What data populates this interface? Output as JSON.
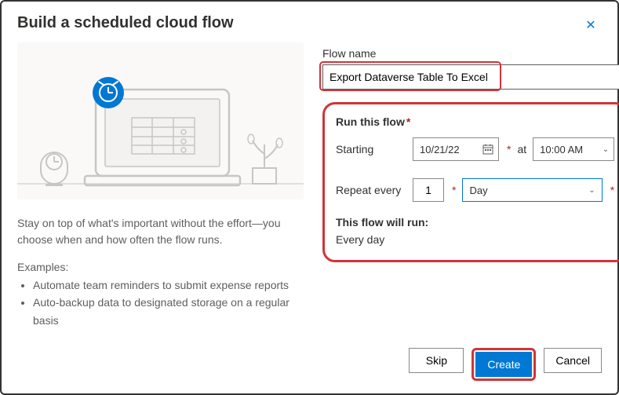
{
  "dialog": {
    "title": "Build a scheduled cloud flow"
  },
  "left": {
    "description": "Stay on top of what's important without the effort—you choose when and how often the flow runs.",
    "examples_label": "Examples:",
    "examples": [
      "Automate team reminders to submit expense reports",
      "Auto-backup data to designated storage on a regular basis"
    ]
  },
  "form": {
    "flow_name_label": "Flow name",
    "flow_name_value": "Export Dataverse Table To Excel",
    "run_section_label": "Run this flow",
    "starting_label": "Starting",
    "starting_date": "10/21/22",
    "at_label": "at",
    "starting_time": "10:00 AM",
    "repeat_label": "Repeat every",
    "repeat_value": "1",
    "repeat_unit": "Day",
    "will_run_label": "This flow will run:",
    "will_run_value": "Every day"
  },
  "footer": {
    "skip": "Skip",
    "create": "Create",
    "cancel": "Cancel"
  },
  "icons": {
    "close": "✕",
    "chevron_down": "⌄",
    "calendar": "📅"
  }
}
